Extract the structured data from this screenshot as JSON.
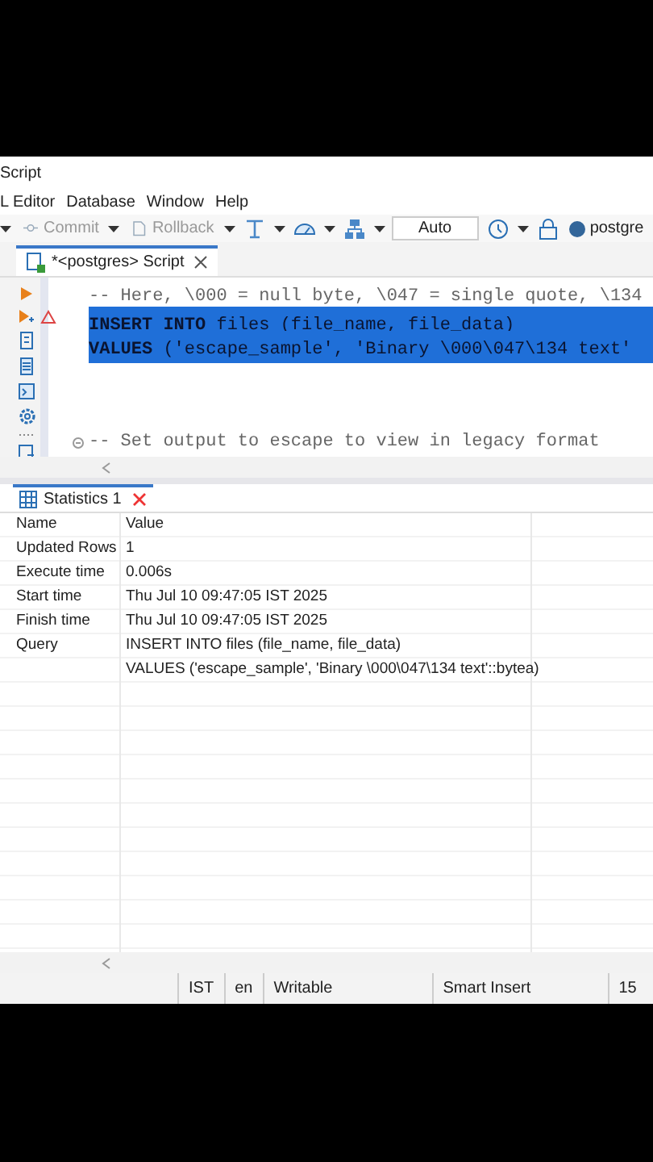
{
  "window": {
    "title": "Script"
  },
  "menu": [
    "L Editor",
    "Database",
    "Window",
    "Help"
  ],
  "toolbar": [
    {
      "kind": "caret"
    },
    {
      "kind": "commit",
      "label": "Commit",
      "disabled": true
    },
    {
      "kind": "caret"
    },
    {
      "kind": "rollback",
      "label": "Rollback",
      "disabled": true
    },
    {
      "kind": "caret"
    },
    {
      "kind": "format"
    },
    {
      "kind": "caret"
    },
    {
      "kind": "gauge"
    },
    {
      "kind": "caret"
    },
    {
      "kind": "tree"
    },
    {
      "kind": "caret"
    },
    {
      "kind": "field",
      "value": "Auto"
    },
    {
      "kind": "history"
    },
    {
      "kind": "caret"
    },
    {
      "kind": "lock"
    },
    {
      "kind": "connection",
      "label": "postgre"
    }
  ],
  "editor_tabs": [
    {
      "label": "*<postgres> Script",
      "selected": true
    }
  ],
  "editor_lines": [
    {
      "kind": "comment",
      "text": "-- Here, \\000 = null byte, \\047 = single quote, \\134",
      "selected": false
    },
    {
      "kind": "code",
      "text": "**INSERT INTO** files (file_name, file_data)",
      "selected": true
    },
    {
      "kind": "code",
      "text": "**VALUES** ('escape_sample', 'Binary \\000\\047\\134 text'",
      "selected": true
    },
    {
      "kind": "blank"
    },
    {
      "kind": "blank"
    },
    {
      "kind": "blank"
    },
    {
      "kind": "comment",
      "text": "-- Set output to escape to view in legacy format",
      "selected": false,
      "fold": true
    }
  ],
  "result_tabs": [
    {
      "label": "Statistics 1",
      "selected": true
    }
  ],
  "table": {
    "columns": [
      "Name",
      "Value"
    ],
    "rows": [
      {
        "name": "Updated Rows",
        "value": "1"
      },
      {
        "name": "Execute time",
        "value": "0.006s"
      },
      {
        "name": "Start time",
        "value": "Thu Jul 10 09:47:05 IST 2025"
      },
      {
        "name": "Finish time",
        "value": "Thu Jul 10 09:47:05 IST 2025"
      },
      {
        "name": "Query",
        "value": "INSERT INTO files (file_name, file_data)"
      },
      {
        "value": "VALUES ('escape_sample', 'Binary \\000\\047\\134 text'::bytea)"
      }
    ]
  },
  "status_bar": [
    "IST",
    "en",
    "Writable",
    "Smart Insert",
    "15"
  ]
}
